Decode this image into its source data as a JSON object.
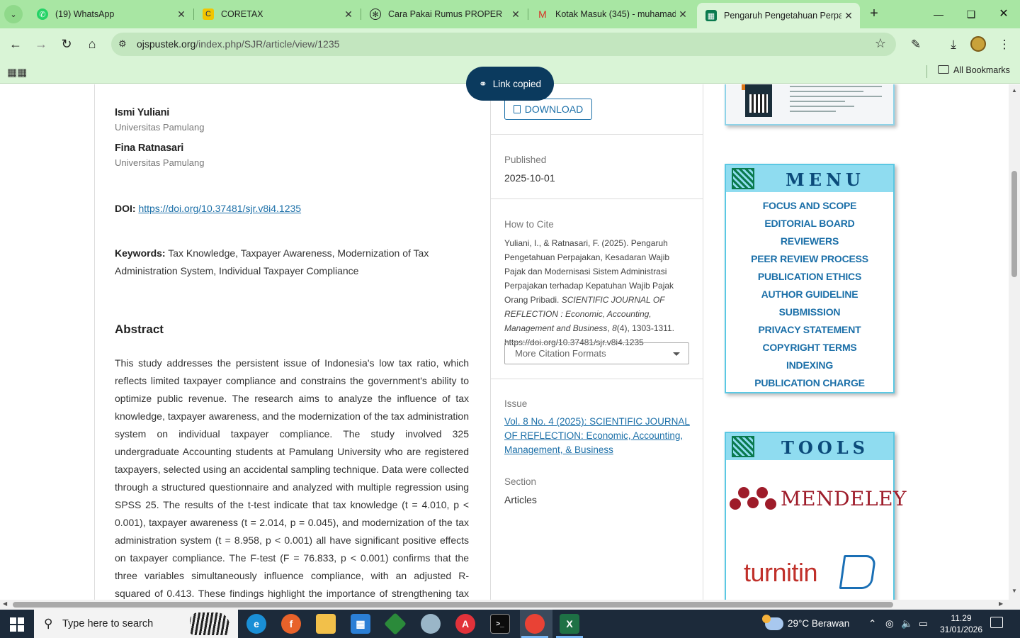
{
  "browser": {
    "tabs": [
      {
        "title": "(19) WhatsApp",
        "icon": "whatsapp-icon"
      },
      {
        "title": "CORETAX",
        "icon": "coretax-icon"
      },
      {
        "title": "Cara Pakai Rumus PROPER",
        "icon": "openai-icon"
      },
      {
        "title": "Kotak Masuk (345) - muhamad",
        "icon": "gmail-icon"
      },
      {
        "title": "Pengaruh Pengetahuan Perpaja",
        "icon": "ojs-icon"
      }
    ],
    "url_host": "ojspustek.org",
    "url_path": "/index.php/SJR/article/view/1235",
    "all_bookmarks": "All Bookmarks",
    "toast": "Link copied"
  },
  "article": {
    "authors": [
      {
        "name": "Ismi Yuliani",
        "affiliation": "Universitas Pamulang"
      },
      {
        "name": "Fina Ratnasari",
        "affiliation": "Universitas Pamulang"
      }
    ],
    "doi_label": "DOI:",
    "doi_link": "https://doi.org/10.37481/sjr.v8i4.1235",
    "keywords_label": "Keywords:",
    "keywords": "Tax Knowledge, Taxpayer Awareness, Modernization of Tax Administration System, Individual Taxpayer Compliance",
    "abstract_heading": "Abstract",
    "abstract": "This study addresses the persistent issue of Indonesia's low tax ratio, which reflects limited taxpayer compliance and constrains the government's ability to optimize public revenue. The research aims to analyze the influence of tax knowledge, taxpayer awareness, and the modernization of the tax administration system on individual taxpayer compliance. The study involved 325 undergraduate Accounting students at Pamulang University who are registered taxpayers, selected using an accidental sampling technique. Data were collected through a structured questionnaire and analyzed with multiple regression using SPSS 25. The results of the t-test indicate that tax knowledge (t = 4.010, p < 0.001), taxpayer awareness (t = 2.014, p = 0.045), and modernization of the tax administration system (t = 8.958, p < 0.001) all have significant positive effects on taxpayer compliance. The F-test (F = 76.833, p < 0.001) confirms that the three variables simultaneously influence compliance, with an adjusted R-squared of 0.413. These findings highlight the importance of strengthening tax education and"
  },
  "sidebar": {
    "download_label": "DOWNLOAD",
    "published_label": "Published",
    "published_value": "2025-10-01",
    "cite_label": "How to Cite",
    "cite_text_1": "Yuliani, I., & Ratnasari, F. (2025). Pengaruh Pengetahuan Perpajakan, Kesadaran Wajib Pajak dan Modernisasi Sistem Administrasi Perpajakan terhadap Kepatuhan Wajib Pajak Orang Pribadi. ",
    "cite_journal": "SCIENTIFIC JOURNAL OF REFLECTION : Economic, Accounting, Management and Business",
    "cite_sep": ", ",
    "cite_volume": "8",
    "cite_text_2": "(4), 1303-1311. https://doi.org/10.37481/sjr.v8i4.1235",
    "more_citation": "More Citation Formats",
    "issue_label": "Issue",
    "issue_link": "Vol. 8 No. 4 (2025): SCIENTIFIC JOURNAL OF REFLECTION: Economic, Accounting, Management, & Business",
    "section_label": "Section",
    "section_value": "Articles"
  },
  "menu": {
    "title": "MENU",
    "items": [
      "FOCUS AND SCOPE",
      "EDITORIAL BOARD",
      "REVIEWERS",
      "PEER REVIEW PROCESS",
      "PUBLICATION ETHICS",
      "AUTHOR GUIDELINE",
      "SUBMISSION",
      "PRIVACY STATEMENT",
      "COPYRIGHT TERMS",
      "INDEXING",
      "PUBLICATION CHARGE"
    ]
  },
  "tools": {
    "title": "TOOLS",
    "mendeley": "MENDELEY",
    "turnitin": "turnitin"
  },
  "taskbar": {
    "search_placeholder": "Type here to search",
    "weather": "29°C  Berawan",
    "time": "11.29",
    "date": "31/01/2026"
  },
  "colors": {
    "chrome_tabs": "#a8e6a3",
    "chrome_toolbar": "#d9f4d6",
    "link": "#1b6fa8",
    "widget_header": "#8fdcf0"
  }
}
